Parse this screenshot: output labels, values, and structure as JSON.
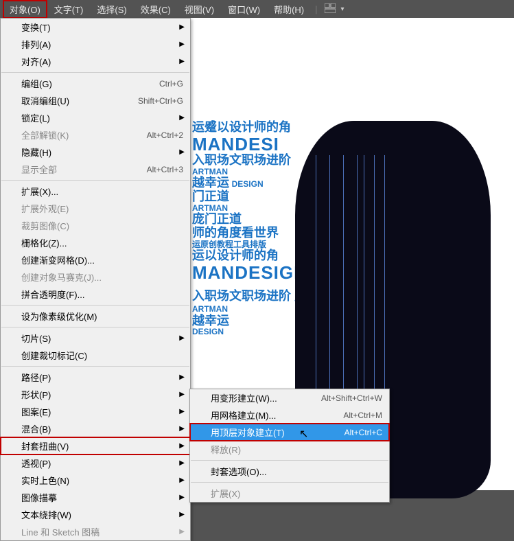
{
  "menubar": {
    "items": [
      "对象(O)",
      "文字(T)",
      "选择(S)",
      "效果(C)",
      "视图(V)",
      "窗口(W)",
      "帮助(H)"
    ]
  },
  "dropdown": {
    "groups": [
      [
        {
          "label": "变换(T)",
          "submenu": true
        },
        {
          "label": "排列(A)",
          "submenu": true
        },
        {
          "label": "对齐(A)",
          "submenu": true
        }
      ],
      [
        {
          "label": "编组(G)",
          "shortcut": "Ctrl+G"
        },
        {
          "label": "取消编组(U)",
          "shortcut": "Shift+Ctrl+G"
        },
        {
          "label": "锁定(L)",
          "submenu": true
        },
        {
          "label": "全部解锁(K)",
          "shortcut": "Alt+Ctrl+2",
          "disabled": true
        },
        {
          "label": "隐藏(H)",
          "submenu": true
        },
        {
          "label": "显示全部",
          "shortcut": "Alt+Ctrl+3",
          "disabled": true
        }
      ],
      [
        {
          "label": "扩展(X)..."
        },
        {
          "label": "扩展外观(E)",
          "disabled": true
        },
        {
          "label": "裁剪图像(C)",
          "disabled": true
        },
        {
          "label": "栅格化(Z)..."
        },
        {
          "label": "创建渐变网格(D)..."
        },
        {
          "label": "创建对象马赛克(J)...",
          "disabled": true
        },
        {
          "label": "拼合透明度(F)..."
        }
      ],
      [
        {
          "label": "设为像素级优化(M)"
        }
      ],
      [
        {
          "label": "切片(S)",
          "submenu": true
        },
        {
          "label": "创建裁切标记(C)"
        }
      ],
      [
        {
          "label": "路径(P)",
          "submenu": true
        },
        {
          "label": "形状(P)",
          "submenu": true
        },
        {
          "label": "图案(E)",
          "submenu": true
        },
        {
          "label": "混合(B)",
          "submenu": true
        },
        {
          "label": "封套扭曲(V)",
          "submenu": true,
          "boxed": true
        },
        {
          "label": "透视(P)",
          "submenu": true
        },
        {
          "label": "实时上色(N)",
          "submenu": true
        },
        {
          "label": "图像描摹",
          "submenu": true
        },
        {
          "label": "文本绕排(W)",
          "submenu": true
        },
        {
          "label": "Line 和 Sketch 图稿",
          "submenu": true,
          "disabled": true
        }
      ]
    ]
  },
  "submenu": {
    "items": [
      {
        "label": "用变形建立(W)...",
        "shortcut": "Alt+Shift+Ctrl+W"
      },
      {
        "label": "用网格建立(M)...",
        "shortcut": "Alt+Ctrl+M"
      },
      {
        "label": "用顶层对象建立(T)",
        "shortcut": "Alt+Ctrl+C",
        "selected": true,
        "boxed": true
      },
      {
        "label": "释放(R)",
        "disabled": true
      },
      {
        "separator": true
      },
      {
        "label": "封套选项(O)..."
      },
      {
        "separator": true
      },
      {
        "label": "扩展(X)",
        "disabled": true
      }
    ]
  },
  "canvas": {
    "text1": "运蹙以设计师的角",
    "text2": "MANDESI",
    "text3": "入职场文职场进阶",
    "text4": "越幸运",
    "text4b": "DESIGN",
    "text5": "门正道",
    "text6": "庞门正道",
    "text7": "师的角度看世界",
    "text8": "运原创教程工具排版",
    "text9": "运以设计师的角",
    "text10": "MANDESIGN",
    "text11": "入职场文职场进阶",
    "text12": "越幸运",
    "text12b": "ARTMAN",
    "text_artman": "ARTMAN",
    "text_design_small": "DESIGN",
    "text_pang": "庞"
  }
}
